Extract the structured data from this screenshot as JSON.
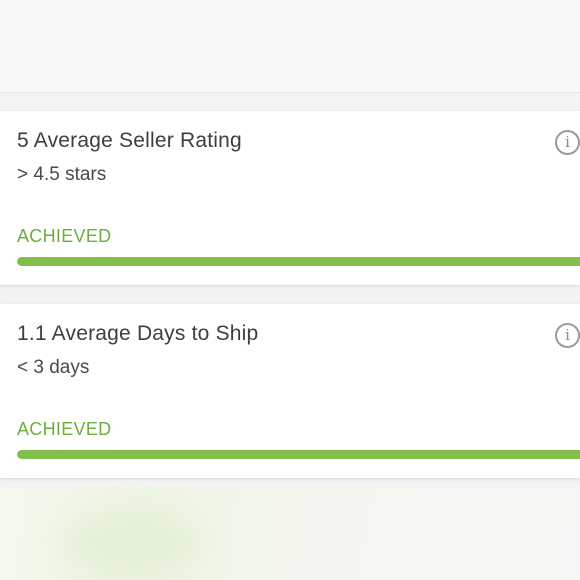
{
  "metrics": [
    {
      "title": "5 Average Seller Rating",
      "target": "> 4.5 stars",
      "status": "ACHIEVED",
      "progress": 1.0,
      "info_icon": "info-icon"
    },
    {
      "title": "1.1 Average Days to Ship",
      "target": "< 3 days",
      "status": "ACHIEVED",
      "progress": 1.0,
      "info_icon": "info-icon"
    }
  ],
  "colors": {
    "status_text": "#6dae3b",
    "progress_fill": "#80c04a",
    "title_text": "#3e3e3e"
  }
}
